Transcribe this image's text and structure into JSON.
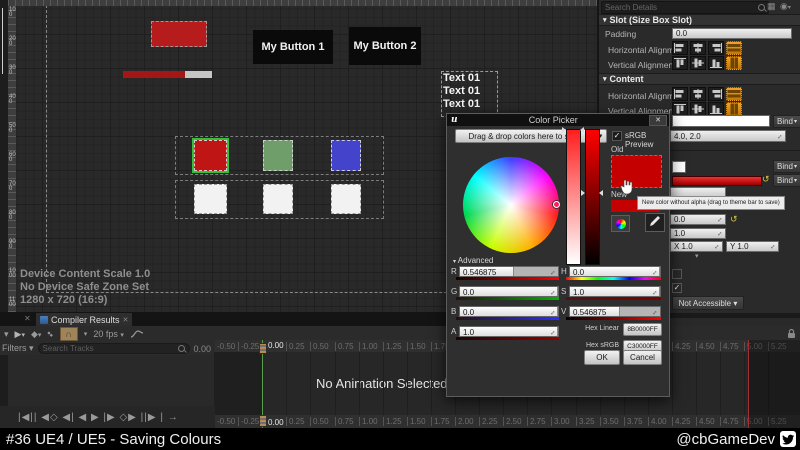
{
  "designer": {
    "ruler_labels": [
      "100",
      "200",
      "300",
      "400",
      "500",
      "600",
      "700",
      "800",
      "900",
      "1000",
      "1100"
    ],
    "button1": "My Button 1",
    "button2": "My Button 2",
    "text_lines": [
      "Text 01",
      "Text 01",
      "Text 01"
    ],
    "overlay_lines": [
      "Device Content Scale 1.0",
      "No Device Safe Zone Set",
      "1280 x 720 (16:9)"
    ],
    "swatch_colors": {
      "red": "#c01515",
      "green": "#6f9e6a",
      "blue": "#4343cb",
      "white": "#f2f2f2"
    }
  },
  "compiler_tab": {
    "label": "Compiler Results"
  },
  "anim_toolbar": {
    "fps": "20 fps",
    "filters_label": "Filters",
    "search_placeholder": "Search Tracks",
    "time": "0.00"
  },
  "timeline": {
    "tick_labels": [
      "-0.50",
      "-0.25",
      "0.00",
      "0.25",
      "0.50",
      "0.75",
      "1.00",
      "1.25",
      "1.50",
      "1.75",
      "2.00",
      "2.25",
      "2.50",
      "2.75",
      "3.00",
      "3.25",
      "3.50",
      "3.75",
      "4.00",
      "4.25",
      "4.50",
      "4.75",
      "5.00",
      "5.25"
    ],
    "playhead_label": "0.00",
    "empty_text": "No Animation Selected",
    "transport": "|◀|| ◀◇ ◀| ◀ ▶ |▶ ◇▶ ||▶ | →"
  },
  "details": {
    "search_placeholder": "Search Details",
    "slot_header": "Slot (Size Box Slot)",
    "padding_label": "Padding",
    "padding_value": "0.0",
    "h_align_label": "Horizontal Alignme",
    "v_align_label": "Vertical Alignment",
    "content_header": "Content",
    "font_size_value": "4.0, 2.0",
    "bind_label": "Bind",
    "alpha_value": "0.0",
    "one_value": "1.0",
    "x_value": "X  1.0",
    "y_value": "Y  1.0",
    "not_accessible": "Not Accessible ▾",
    "accent": "#d98a0b"
  },
  "color_picker": {
    "title": "Color Picker",
    "theme_dropdown": "Drag & drop colors here to save",
    "srgb_label": "sRGB Preview",
    "old_label": "Old",
    "new_label": "New",
    "advanced_label": "Advanced",
    "old_color": "#c40000",
    "channels": [
      {
        "label": "R",
        "value": "0.546875",
        "fill_pct": 55
      },
      {
        "label": "G",
        "value": "0.0",
        "fill_pct": 100
      },
      {
        "label": "B",
        "value": "0.0",
        "fill_pct": 100
      },
      {
        "label": "A",
        "value": "1.0",
        "fill_pct": 100
      },
      {
        "label": "H",
        "value": "0.0",
        "fill_pct": 100
      },
      {
        "label": "S",
        "value": "1.0",
        "fill_pct": 100
      },
      {
        "label": "V",
        "value": "0.546875",
        "fill_pct": 55
      }
    ],
    "hex_linear_label": "Hex Linear",
    "hex_linear_value": "8B0000FF",
    "hex_srgb_label": "Hex sRGB",
    "hex_srgb_value": "C30000FF",
    "ok": "OK",
    "cancel": "Cancel",
    "tooltip": "New color without alpha (drag to theme bar to save)"
  },
  "footer": {
    "title": "#36 UE4 / UE5 - Saving Colours",
    "handle": "@cbGameDev"
  }
}
